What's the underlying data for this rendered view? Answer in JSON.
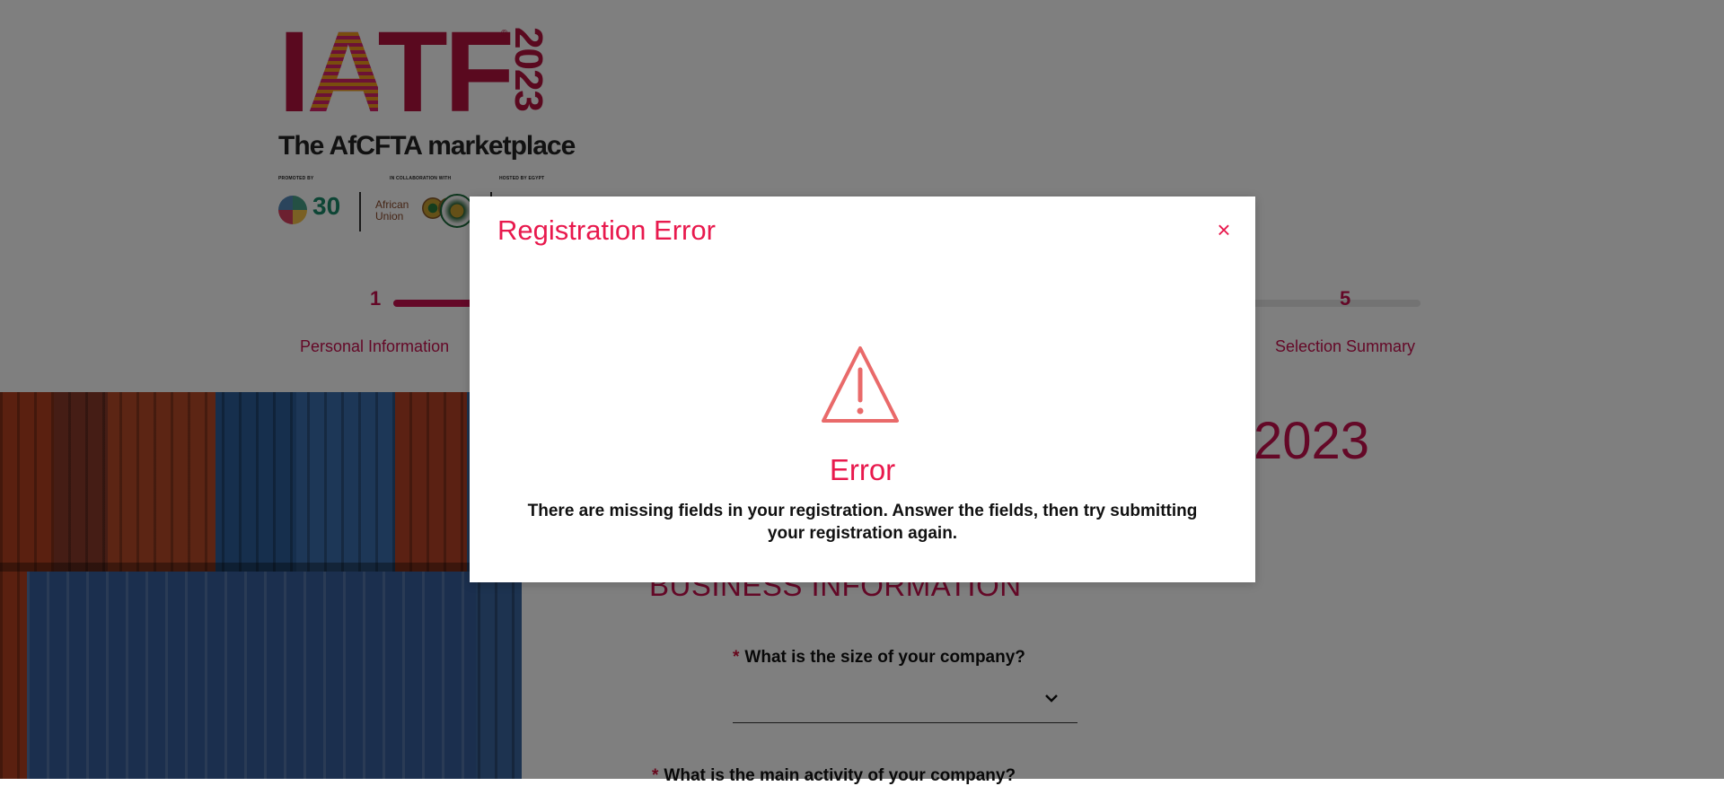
{
  "logo": {
    "name": "IATF",
    "registered": "®",
    "year": "2023",
    "tagline": "The AfCFTA marketplace",
    "promoted_by": "PROMOTED BY",
    "collaboration": "IN COLLABORATION WITH",
    "hosted_by": "HOSTED BY EGYPT",
    "partner_30": "30",
    "african_union": "African\nUnion"
  },
  "stepper": {
    "steps": [
      {
        "number": "1",
        "label": "Personal Information"
      },
      {
        "number": "5",
        "label": "Selection Summary"
      }
    ]
  },
  "form": {
    "title_visible": "2023",
    "section_title": "BUSINESS INFORMATION",
    "questions": [
      {
        "required": "*",
        "label": "What is the size of your company?"
      },
      {
        "required": "*",
        "label": "What is the main activity of your company?"
      }
    ]
  },
  "modal": {
    "title": "Registration Error",
    "close_symbol": "×",
    "heading": "Error",
    "message": "There are missing fields in your registration. Answer the fields, then try submitting your registration again.",
    "icon": "warning-triangle-icon"
  },
  "colors": {
    "brand": "#c8104f",
    "modal_accent": "#e8194d",
    "warning_icon": "#e96a6a",
    "overlay": "rgba(0,0,0,0.5)"
  }
}
